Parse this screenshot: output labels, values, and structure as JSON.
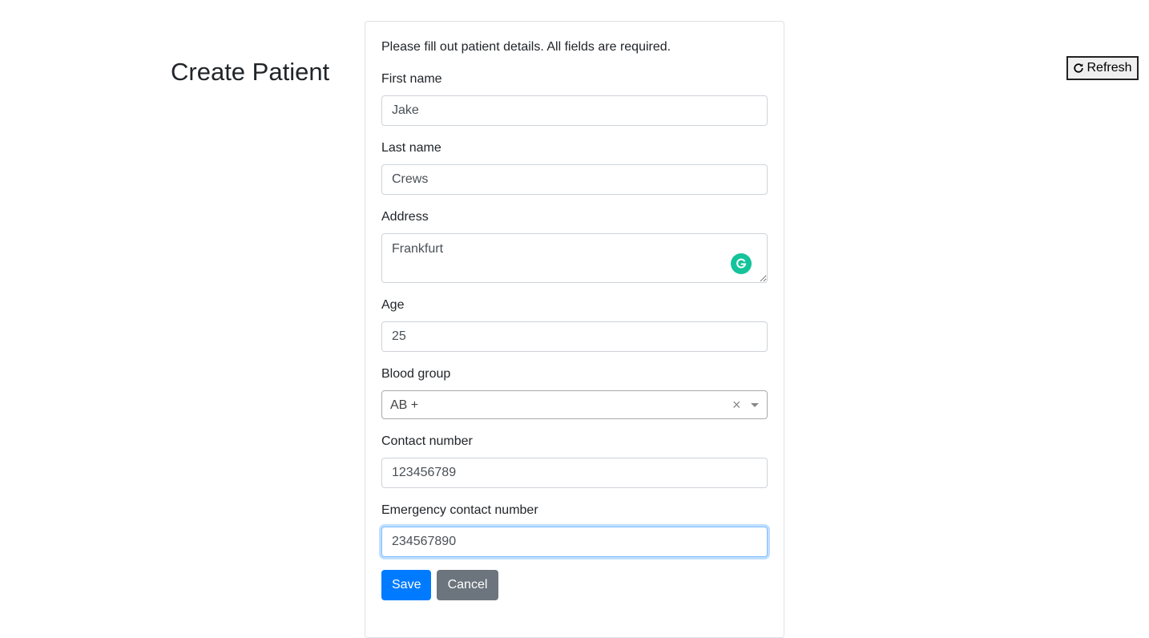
{
  "page": {
    "title": "Create Patient"
  },
  "toolbar": {
    "refresh_label": "Refresh",
    "refresh_icon": "refresh-icon"
  },
  "form": {
    "intro": "Please fill out patient details. All fields are required.",
    "first_name": {
      "label": "First name",
      "value": "Jake"
    },
    "last_name": {
      "label": "Last name",
      "value": "Crews"
    },
    "address": {
      "label": "Address",
      "value": "Frankfurt"
    },
    "age": {
      "label": "Age",
      "value": "25"
    },
    "blood_group": {
      "label": "Blood group",
      "value": "AB +",
      "clear": "×"
    },
    "contact": {
      "label": "Contact number",
      "value": "123456789"
    },
    "emergency_contact": {
      "label": "Emergency contact number",
      "value": "234567890"
    },
    "save_label": "Save",
    "cancel_label": "Cancel"
  },
  "colors": {
    "primary": "#007bff",
    "secondary": "#6c757d",
    "grammarly": "#15c39a",
    "focus_border": "#80bdff"
  }
}
